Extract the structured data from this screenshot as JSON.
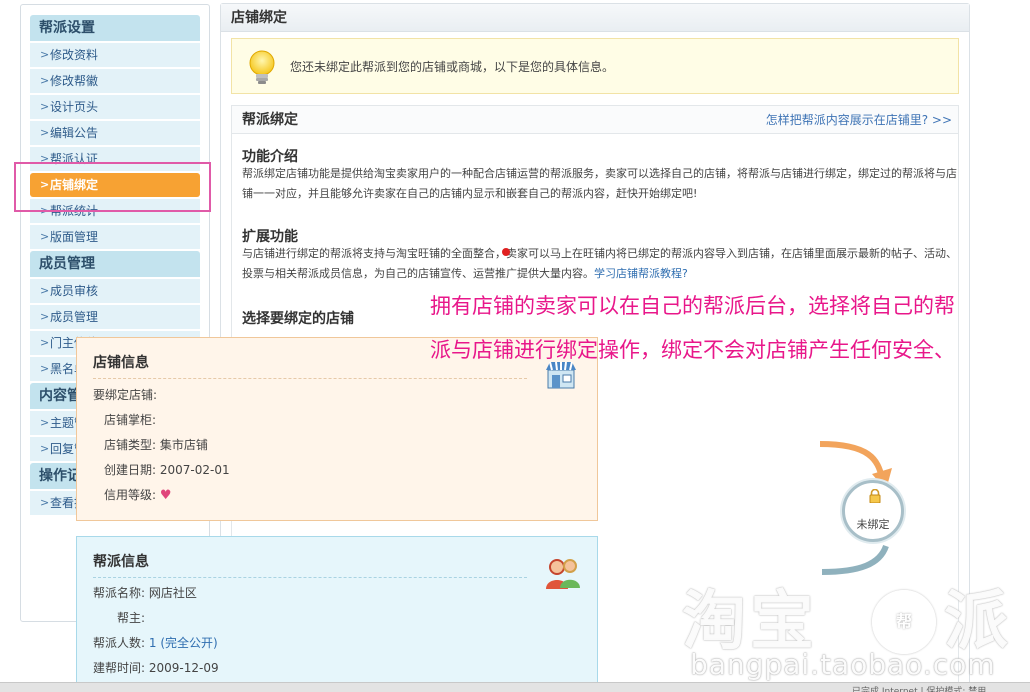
{
  "sidebar": {
    "sections": [
      {
        "title": "帮派设置",
        "items": [
          "修改资料",
          "修改帮徽",
          "设计页头",
          "编辑公告",
          "帮派认证",
          "店铺绑定",
          "帮派统计",
          "版面管理"
        ]
      },
      {
        "title": "成员管理",
        "items": [
          "成员审核",
          "成员管理",
          "门主传位",
          "黑名单管理"
        ]
      },
      {
        "title": "内容管理",
        "items": [
          "主题管理",
          "回复管理"
        ]
      },
      {
        "title": "操作记录",
        "items": [
          "查看操作记录"
        ]
      }
    ],
    "active_item": "店铺绑定"
  },
  "main": {
    "title": "店铺绑定",
    "notice": "您还未绑定此帮派到您的店铺或商城，以下是您的具体信息。",
    "bind_title": "帮派绑定",
    "help_link": "怎样把帮派内容展示在店铺里?",
    "intro_title": "功能介绍",
    "intro_text": "帮派绑定店铺功能是提供给淘宝卖家用户的一种配合店铺运营的帮派服务，卖家可以选择自己的店铺，将帮派与店铺进行绑定，绑定过的帮派将与店铺一一对应，并且能够允许卖家在自己的店铺内显示和嵌套自己的帮派内容，赶快开始绑定吧!",
    "ext_title": "扩展功能",
    "ext_text": "与店铺进行绑定的帮派将支持与淘宝旺铺的全面整合，卖家可以马上在旺铺内将已绑定的帮派内容导入到店铺，在店铺里面展示最新的帖子、活动、投票与相关帮派成员信息，为自己的店铺宣传、运营推广提供大量内容。",
    "ext_link": "学习店铺帮派教程?",
    "choose_title": "选择要绑定的店铺"
  },
  "store_card": {
    "title": "店铺信息",
    "fields": [
      {
        "label": "要绑定店铺:",
        "value": ""
      },
      {
        "label": "店铺掌柜:",
        "value": ""
      },
      {
        "label": "店铺类型:",
        "value": "集市店铺"
      },
      {
        "label": "创建日期:",
        "value": "2007-02-01"
      },
      {
        "label": "信用等级:",
        "value": ""
      }
    ]
  },
  "crew_card": {
    "title": "帮派信息",
    "fields": [
      {
        "label": "帮派名称:",
        "value": "网店社区"
      },
      {
        "label": "帮主:",
        "value": ""
      },
      {
        "label": "帮派人数:",
        "value": "1 (完全公开)"
      },
      {
        "label": "建帮时间:",
        "value": "2009-12-09"
      }
    ]
  },
  "lock_badge": "未绑定",
  "overlay": {
    "line1": "拥有店铺的卖家可以在自己的帮派后台，选择将自己的帮",
    "line2": "派与店铺进行绑定操作，绑定不会对店铺产生任何安全、"
  },
  "watermark": {
    "big": "淘宝",
    "circle": "帮",
    "tail": "派",
    "url": "bangpai.taobao.com"
  },
  "bottom_text": "已完成  Internet | 保护模式: 禁用",
  "colors": {
    "accent": "#f7a233",
    "nav_bg": "#e3f2f8",
    "section_bg": "#c3e3ee",
    "link": "#2f6eb0",
    "overlay": "#e8178a",
    "highlight": "#e05aa8"
  }
}
